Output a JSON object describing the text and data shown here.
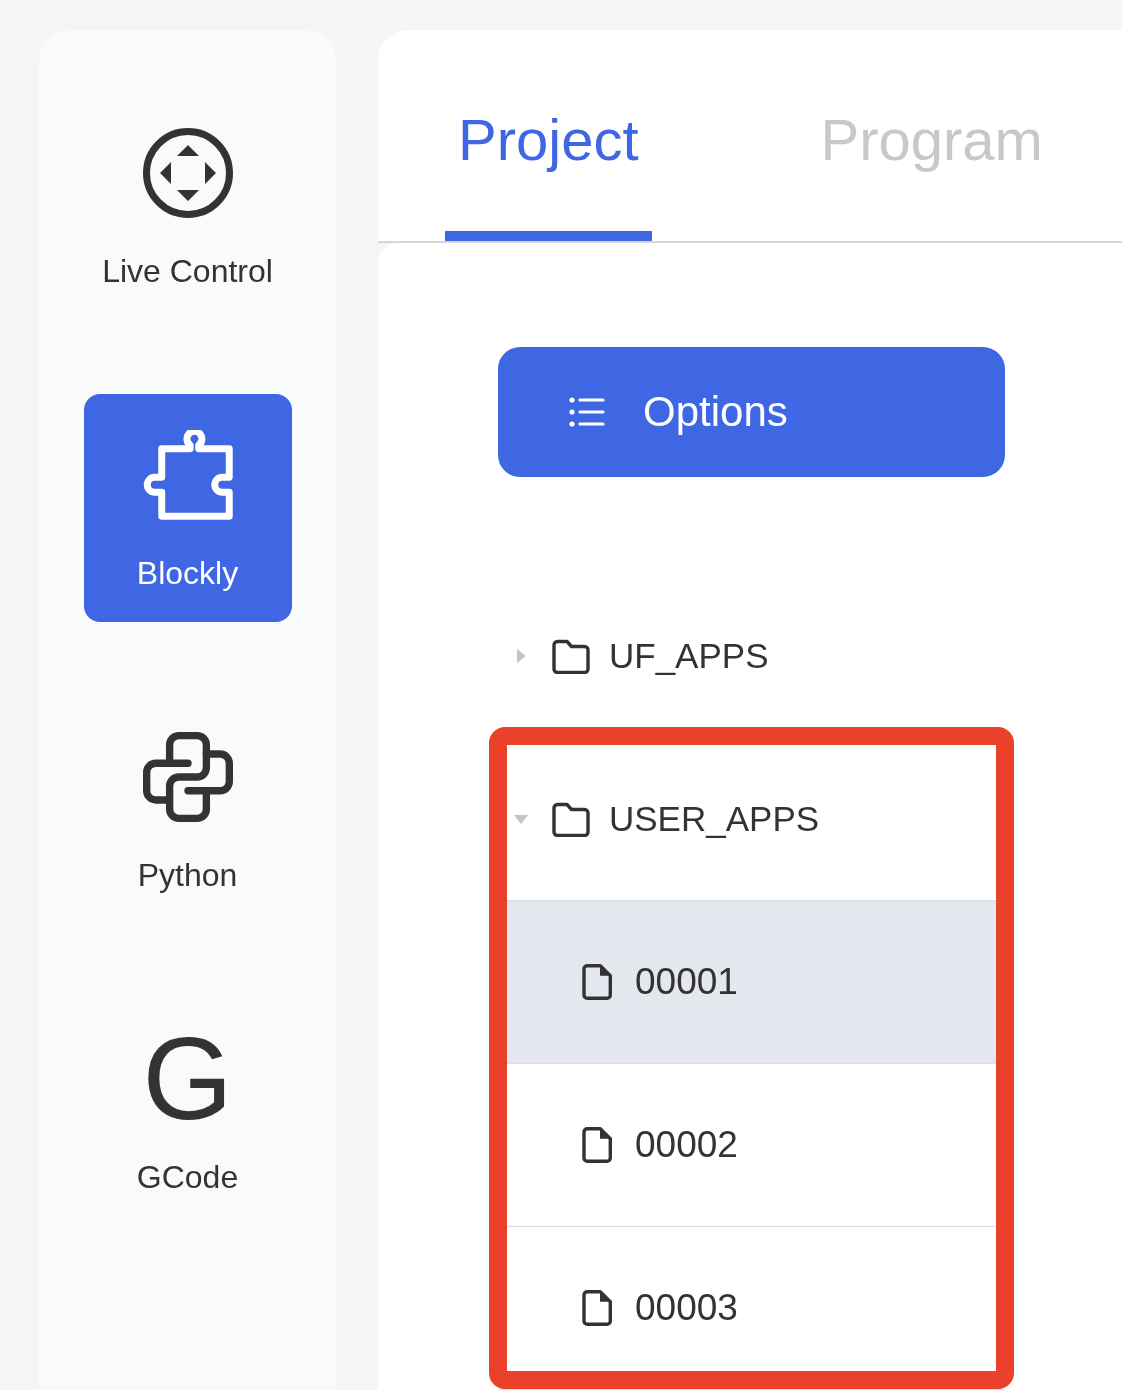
{
  "sidebar": {
    "items": [
      {
        "kind": "dpad",
        "label": "Live Control",
        "selected": false
      },
      {
        "kind": "puzzle",
        "label": "Blockly",
        "selected": true
      },
      {
        "kind": "python",
        "label": "Python",
        "selected": false
      },
      {
        "kind": "letter",
        "glyph": "G",
        "label": "GCode",
        "selected": false
      }
    ]
  },
  "tabs": [
    {
      "label": "Project",
      "selected": true
    },
    {
      "label": "Program",
      "selected": false
    }
  ],
  "options_button": {
    "label": "Options"
  },
  "file_tree": {
    "items": [
      {
        "kind": "folder",
        "name": "UF_APPS",
        "expanded": false,
        "selected": false,
        "highlighted": false
      },
      {
        "kind": "folder",
        "name": "USER_APPS",
        "expanded": true,
        "selected": false,
        "highlighted": true,
        "children": [
          {
            "kind": "file",
            "name": "00001",
            "selected": true
          },
          {
            "kind": "file",
            "name": "00002",
            "selected": false
          },
          {
            "kind": "file",
            "name": "00003",
            "selected": false
          }
        ]
      }
    ]
  }
}
